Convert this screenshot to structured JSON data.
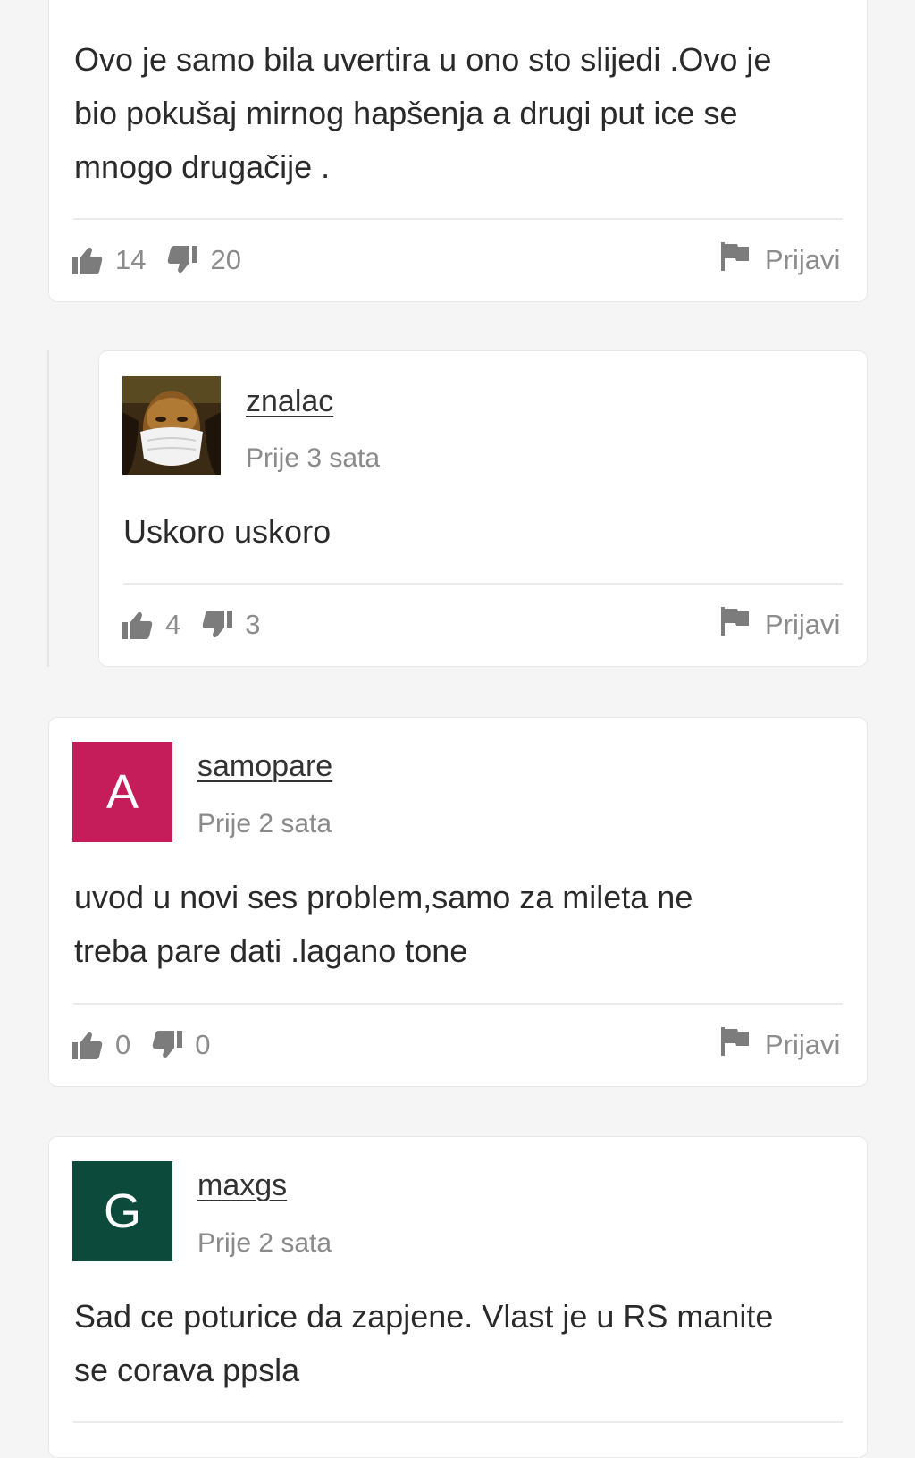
{
  "colors": {
    "accent_top": "#e3342f",
    "icon_gray": "#7c7c7c"
  },
  "comments": [
    {
      "text_lines": [
        "Ovo je samo bila uvertira u ono sto slijedi .Ovo je",
        "bio pokušaj mirnog hapšenja a drugi put ice se",
        "mnogo drugačije ."
      ],
      "likes": "14",
      "dislikes": "20",
      "report_label": "Prijavi"
    },
    {
      "username": "znalac",
      "time": "Prije 3 sata",
      "avatar": {
        "type": "image",
        "description_icon": "masked-portrait-avatar"
      },
      "text_lines": [
        "Uskoro uskoro"
      ],
      "likes": "4",
      "dislikes": "3",
      "report_label": "Prijavi"
    },
    {
      "username": "samopare",
      "time": "Prije 2 sata",
      "avatar": {
        "type": "letter",
        "letter": "A",
        "color": "#c41d5a"
      },
      "text_lines": [
        "uvod u novi ses problem,samo za mileta ne",
        "treba pare dati .lagano tone"
      ],
      "likes": "0",
      "dislikes": "0",
      "report_label": "Prijavi"
    },
    {
      "username": "maxgs",
      "time": "Prije 2 sata",
      "avatar": {
        "type": "letter",
        "letter": "G",
        "color": "#0c4a3c"
      },
      "text_lines": [
        "Sad ce poturice da zapjene. Vlast je u RS manite",
        "se corava ppsla"
      ]
    }
  ]
}
